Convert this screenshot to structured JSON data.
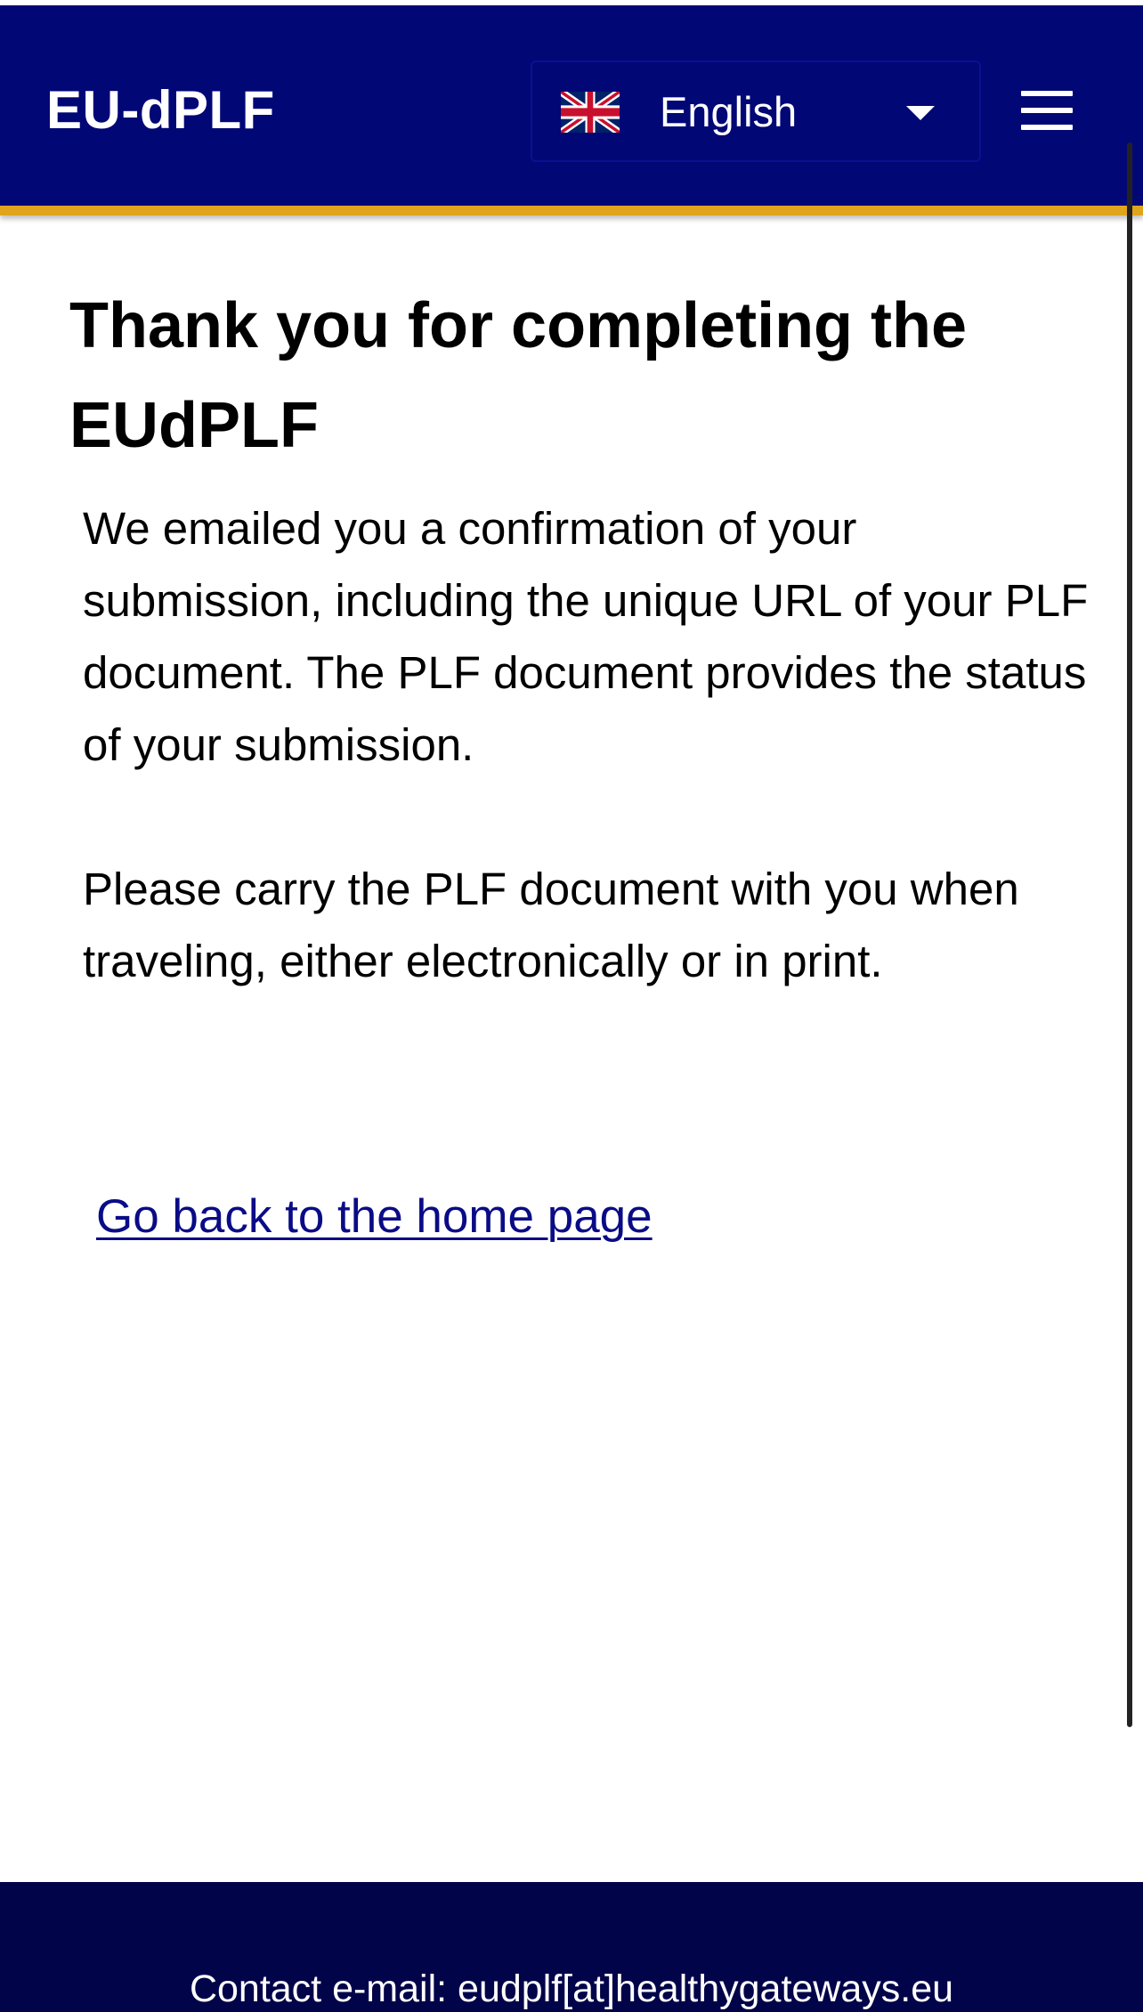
{
  "header": {
    "brand": "EU-dPLF",
    "language": {
      "selected": "English",
      "flag_icon": "uk-flag-icon",
      "caret_icon": "caret-down-icon"
    },
    "menu_icon": "hamburger-menu-icon"
  },
  "main": {
    "title": "Thank you for completing the EUdPLF",
    "paragraph_1": "We emailed you a confirmation of your submission, including the unique URL of your PLF document. The PLF document provides the status of your submission.",
    "paragraph_2": "Please carry the PLF document with you when traveling, either electronically or in print.",
    "home_link": "Go back to the home page"
  },
  "footer": {
    "contact": "Contact e-mail: eudplf[at]healthygateways.eu"
  },
  "colors": {
    "header_bg": "#020776",
    "accent_bar": "#e0a51c",
    "footer_bg": "#020449",
    "link": "#0a0c86",
    "text": "#000000"
  }
}
